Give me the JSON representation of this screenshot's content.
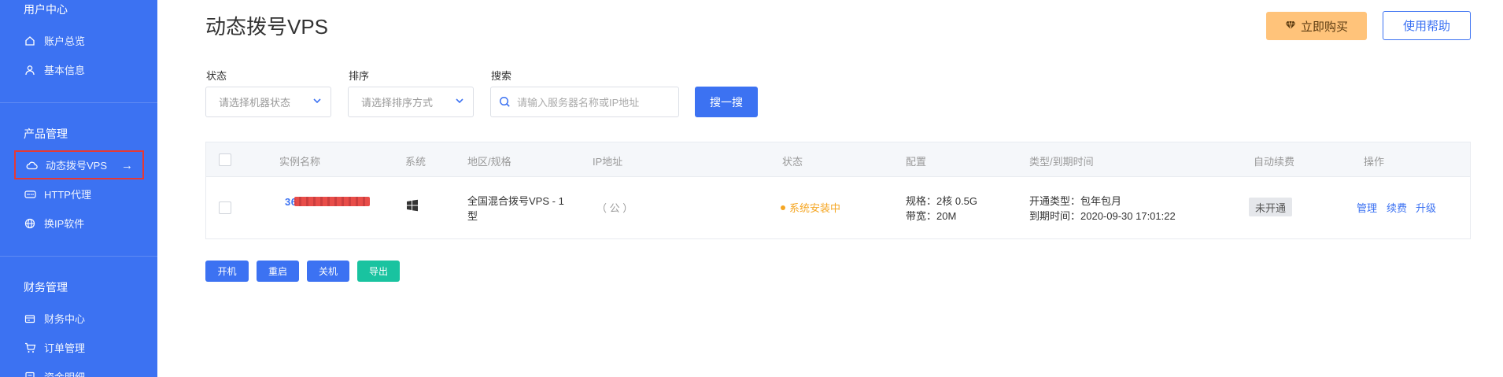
{
  "sidebar": {
    "groups": [
      {
        "title": "用户中心",
        "items": [
          {
            "label": "账户总览",
            "icon": "home-icon"
          },
          {
            "label": "基本信息",
            "icon": "user-icon"
          }
        ]
      },
      {
        "title": "产品管理",
        "items": [
          {
            "label": "动态拨号VPS",
            "icon": "cloud-icon",
            "active": true
          },
          {
            "label": "HTTP代理",
            "icon": "http-icon"
          },
          {
            "label": "换IP软件",
            "icon": "globe-icon"
          }
        ]
      },
      {
        "title": "财务管理",
        "items": [
          {
            "label": "财务中心",
            "icon": "wallet-icon"
          },
          {
            "label": "订单管理",
            "icon": "cart-icon"
          },
          {
            "label": "资金明细",
            "icon": "list-icon"
          }
        ]
      }
    ]
  },
  "header": {
    "title": "动态拨号VPS",
    "buy_label": "立即购买",
    "help_label": "使用帮助"
  },
  "filters": {
    "status_label": "状态",
    "status_placeholder": "请选择机器状态",
    "sort_label": "排序",
    "sort_placeholder": "请选择排序方式",
    "search_label": "搜索",
    "search_placeholder": "请输入服务器名称或IP地址",
    "search_button": "搜一搜"
  },
  "table": {
    "columns": [
      "实例名称",
      "系统",
      "地区/规格",
      "IP地址",
      "状态",
      "配置",
      "类型/到期时间",
      "自动续费",
      "操作"
    ],
    "row": {
      "instance": "36",
      "region_line1": "全国混合拨号VPS - 1",
      "region_line2": "型",
      "ip": "（ 公 ）",
      "status": "系统安装中",
      "config_line1": "规格：2核 0.5G",
      "config_line2": "带宽：20M",
      "type_line1": "开通类型：包年包月",
      "type_line2": "到期时间：2020-09-30 17:01:22",
      "auto_renew": "未开通",
      "ops": [
        "管理",
        "续费",
        "升级"
      ]
    }
  },
  "actions": {
    "start": "开机",
    "restart": "重启",
    "shutdown": "关机",
    "export": "导出"
  },
  "colors": {
    "primary": "#3c72f2",
    "buy": "#ffc37a",
    "export": "#19c3a0",
    "warning": "#f5a623"
  }
}
